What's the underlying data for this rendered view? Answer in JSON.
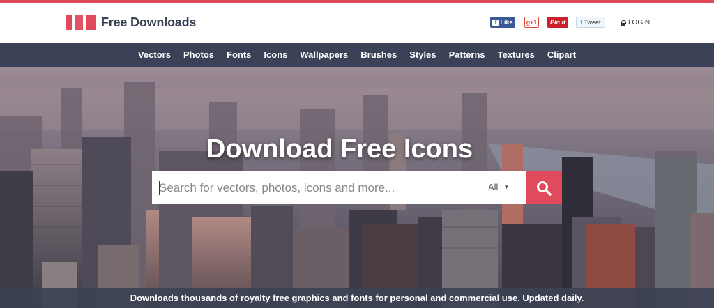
{
  "brand": {
    "name": "Free Downloads",
    "accent_color": "#e04a5c"
  },
  "social": {
    "facebook_label": "Like",
    "gplus_label": "g+1",
    "pinterest_label": "Pin it",
    "twitter_label": "Tweet"
  },
  "header": {
    "login_label": "LOGIN"
  },
  "nav": {
    "items": [
      "Vectors",
      "Photos",
      "Fonts",
      "Icons",
      "Wallpapers",
      "Brushes",
      "Styles",
      "Patterns",
      "Textures",
      "Clipart"
    ]
  },
  "hero": {
    "title": "Download Free Icons",
    "search": {
      "placeholder": "Search for vectors, photos, icons and more...",
      "value": "",
      "category_selected": "All"
    },
    "tagline": "Downloads thousands of royalty free graphics and fonts for personal and commercial use. Updated daily."
  },
  "colors": {
    "nav_bg": "#3b4157",
    "header_text": "#3b4255"
  }
}
